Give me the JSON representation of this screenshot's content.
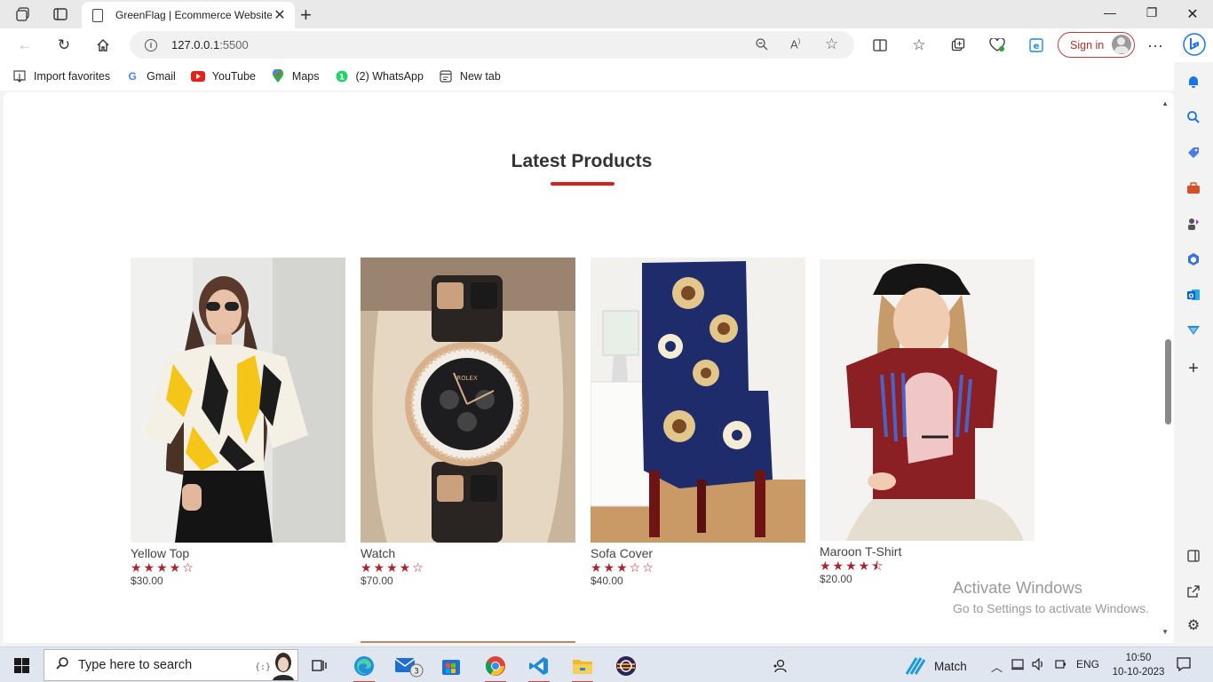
{
  "browser": {
    "tab_title": "GreenFlag | Ecommerce Website",
    "url_host": "127.0.0.1",
    "url_port": ":5500",
    "sign_in_label": "Sign in"
  },
  "favorites": [
    {
      "label": "Import favorites",
      "icon": "import-icon"
    },
    {
      "label": "Gmail",
      "icon": "google-icon"
    },
    {
      "label": "YouTube",
      "icon": "youtube-icon"
    },
    {
      "label": "Maps",
      "icon": "maps-icon"
    },
    {
      "label": "(2) WhatsApp",
      "icon": "whatsapp-icon"
    },
    {
      "label": "New tab",
      "icon": "newtab-icon"
    }
  ],
  "page": {
    "heading": "Latest Products",
    "accent_color": "#d32222",
    "products": [
      {
        "name": "Yellow Top",
        "stars": "★★★★☆",
        "rating": 4,
        "price": "$30.00"
      },
      {
        "name": "Watch",
        "stars": "★★★★☆",
        "rating": 4,
        "price": "$70.00"
      },
      {
        "name": "Sofa Cover",
        "stars": "★★★☆☆",
        "rating": 3,
        "price": "$40.00"
      },
      {
        "name": "Maroon T-Shirt",
        "stars": "★★★★⯪",
        "rating": 4.5,
        "price": "$20.00"
      }
    ]
  },
  "watermark": {
    "line1": "Activate Windows",
    "line2": "Go to Settings to activate Windows."
  },
  "taskbar": {
    "search_placeholder": "Type here to search",
    "mail_badge": "3",
    "weather_label": "Match",
    "language": "ENG",
    "time": "10:50",
    "date": "10-10-2023"
  }
}
